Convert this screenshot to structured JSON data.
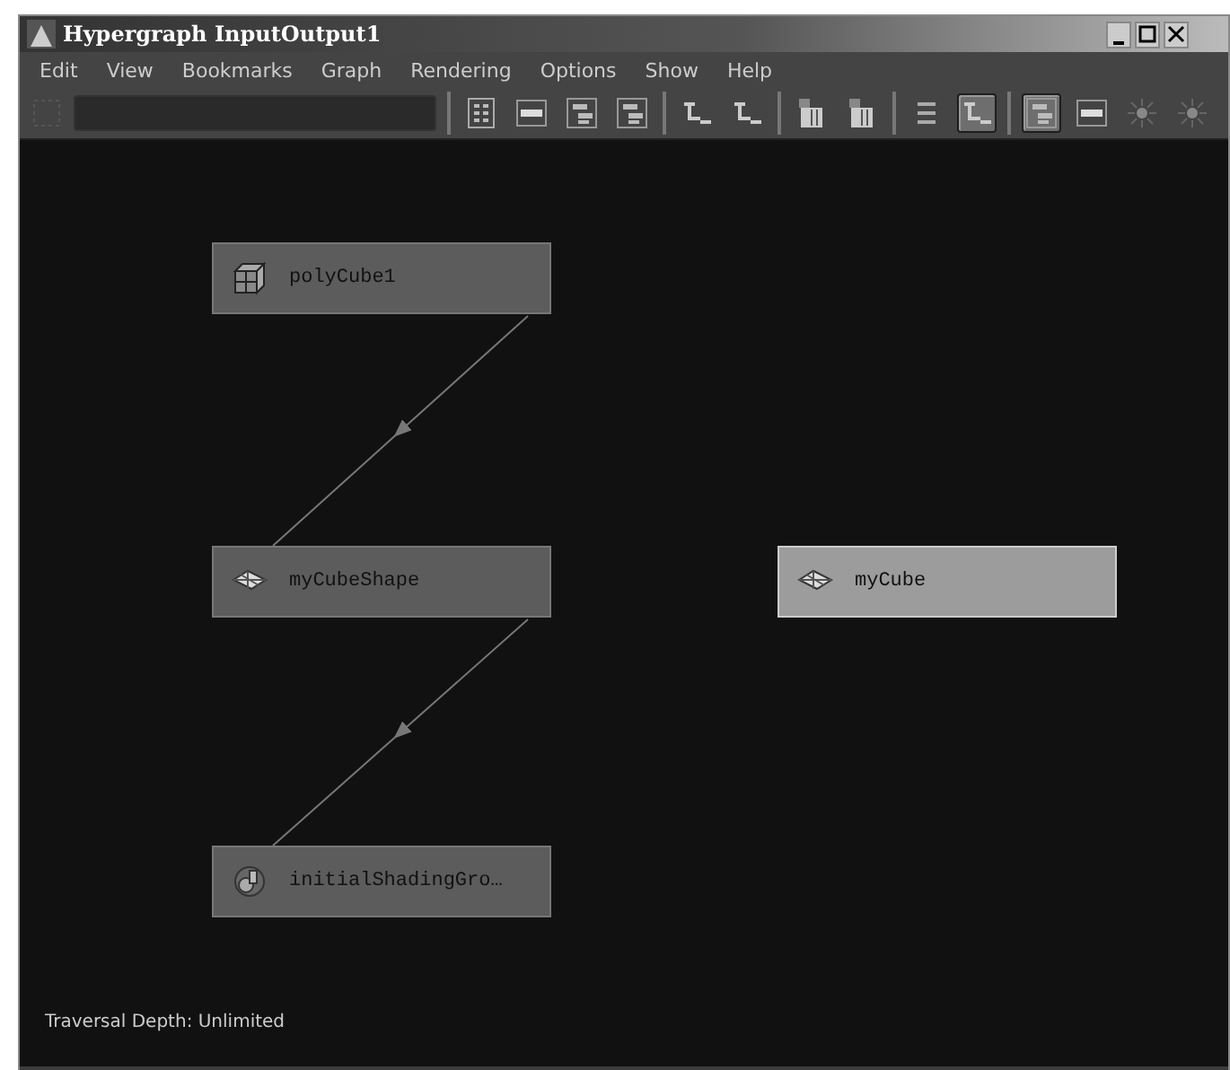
{
  "window": {
    "title": "Hypergraph InputOutput1"
  },
  "menu": [
    "Edit",
    "View",
    "Bookmarks",
    "Graph",
    "Rendering",
    "Options",
    "Show",
    "Help"
  ],
  "toolbar": [
    {
      "kind": "grid",
      "selected": false
    },
    {
      "kind": "bar",
      "selected": false
    },
    {
      "kind": "tree",
      "selected": false
    },
    {
      "kind": "tree",
      "selected": false
    },
    {
      "kind": "sep"
    },
    {
      "kind": "branch",
      "selected": false
    },
    {
      "kind": "branch",
      "selected": false
    },
    {
      "kind": "sep"
    },
    {
      "kind": "shader",
      "selected": false
    },
    {
      "kind": "shader",
      "selected": false
    },
    {
      "kind": "sep"
    },
    {
      "kind": "lines",
      "selected": false
    },
    {
      "kind": "branch",
      "selected": true
    },
    {
      "kind": "sep"
    },
    {
      "kind": "tree",
      "selected": true
    },
    {
      "kind": "bar",
      "selected": false
    },
    {
      "kind": "star",
      "selected": false
    },
    {
      "kind": "star",
      "selected": false
    }
  ],
  "nodes": [
    {
      "label": "polyCube1",
      "kind": "cube",
      "selected": false
    },
    {
      "label": "myCubeShape",
      "kind": "mesh",
      "selected": false
    },
    {
      "label": "myCube",
      "kind": "mesh",
      "selected": true
    },
    {
      "label": "initialShadingGro…",
      "kind": "shading",
      "selected": false
    }
  ],
  "status_bar": "Traversal Depth: Unlimited"
}
